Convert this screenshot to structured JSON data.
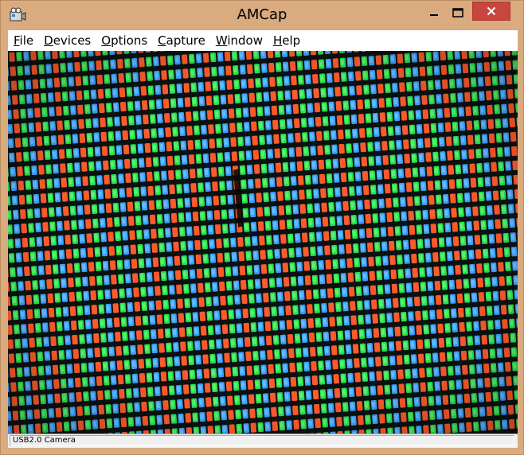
{
  "window": {
    "title": "AMCap",
    "controls": {
      "minimize": "minimize-icon",
      "maximize": "maximize-icon",
      "close": "close-icon"
    }
  },
  "menu": {
    "items": [
      {
        "key": "F",
        "rest": "ile"
      },
      {
        "key": "D",
        "rest": "evices"
      },
      {
        "key": "O",
        "rest": "ptions"
      },
      {
        "key": "C",
        "rest": "apture"
      },
      {
        "key": "W",
        "rest": "indow"
      },
      {
        "key": "H",
        "rest": "elp"
      }
    ]
  },
  "preview": {
    "description_icon": "camera-preview",
    "colors": {
      "red": "#ff5a2a",
      "green": "#27e34a",
      "blue": "#3aa0ff",
      "background": "#0b1010"
    }
  },
  "statusbar": {
    "text": "USB2.0 Camera"
  }
}
